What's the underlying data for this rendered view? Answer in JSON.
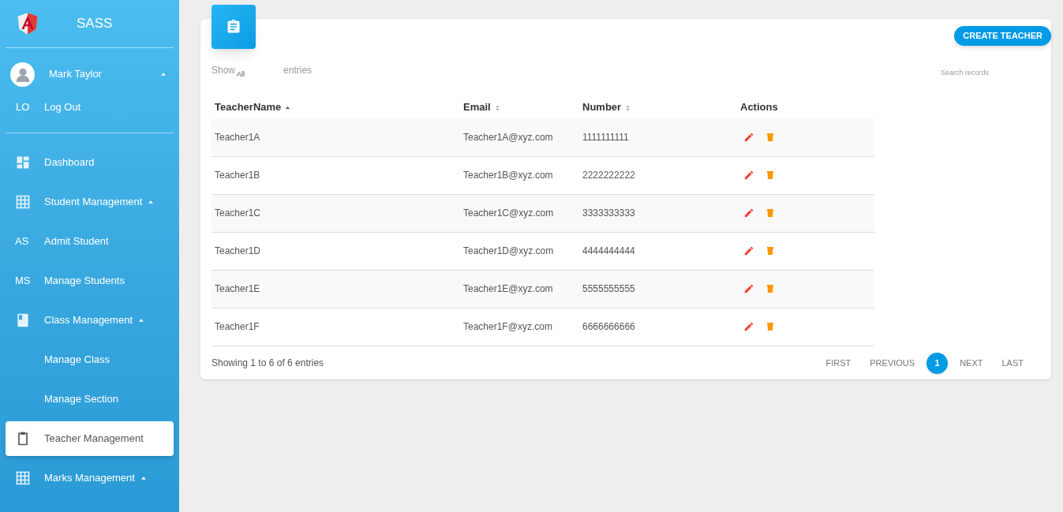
{
  "brand": {
    "title": "SASS"
  },
  "user": {
    "name": "Mark Taylor",
    "expanded": true,
    "menu": [
      {
        "abbr": "LO",
        "label": "Log Out"
      }
    ]
  },
  "nav": [
    {
      "kind": "dashboard",
      "label": "Dashboard",
      "selected": false
    },
    {
      "kind": "grid",
      "label": "Student Management",
      "selected": false,
      "expanded": true
    },
    {
      "kind": "abbr",
      "abbr": "AS",
      "label": "Admit Student",
      "selected": false
    },
    {
      "kind": "abbr",
      "abbr": "MS",
      "label": "Manage Students",
      "selected": false
    },
    {
      "kind": "book",
      "label": "Class Management",
      "selected": false,
      "expanded": true
    },
    {
      "kind": "plain",
      "label": "Manage Class",
      "selected": false
    },
    {
      "kind": "plain",
      "label": "Manage Section",
      "selected": false
    },
    {
      "kind": "clipboard",
      "label": "Teacher Management",
      "selected": true
    },
    {
      "kind": "grid",
      "label": "Marks Management",
      "selected": false,
      "expanded": true
    }
  ],
  "card": {
    "create_button": "CREATE TEACHER",
    "show_label": "Show",
    "page_size": "All",
    "entries_label": "entries",
    "search": {
      "placeholder": "Search records"
    },
    "table": {
      "columns": [
        {
          "label": "TeacherName",
          "sortable": true,
          "sorted": true
        },
        {
          "label": "Email",
          "sortable": true,
          "sorted": false
        },
        {
          "label": "Number",
          "sortable": true,
          "sorted": false
        },
        {
          "label": "Actions",
          "sortable": false
        }
      ],
      "rows": [
        [
          "Teacher1A",
          "Teacher1A@xyz.com",
          "1111111111"
        ],
        [
          "Teacher1B",
          "Teacher1B@xyz.com",
          "2222222222"
        ],
        [
          "Teacher1C",
          "Teacher1C@xyz.com",
          "3333333333"
        ],
        [
          "Teacher1D",
          "Teacher1D@xyz.com",
          "4444444444"
        ],
        [
          "Teacher1E",
          "Teacher1E@xyz.com",
          "5555555555"
        ],
        [
          "Teacher1F",
          "Teacher1F@xyz.com",
          "6666666666"
        ]
      ]
    },
    "summary": "Showing 1 to 6 of 6 entries",
    "pagination": [
      {
        "label": "FIRST",
        "selected": false
      },
      {
        "label": "PREVIOUS",
        "selected": false
      },
      {
        "label": "1",
        "selected": true
      },
      {
        "label": "NEXT",
        "selected": false
      },
      {
        "label": "LAST",
        "selected": false
      }
    ]
  }
}
